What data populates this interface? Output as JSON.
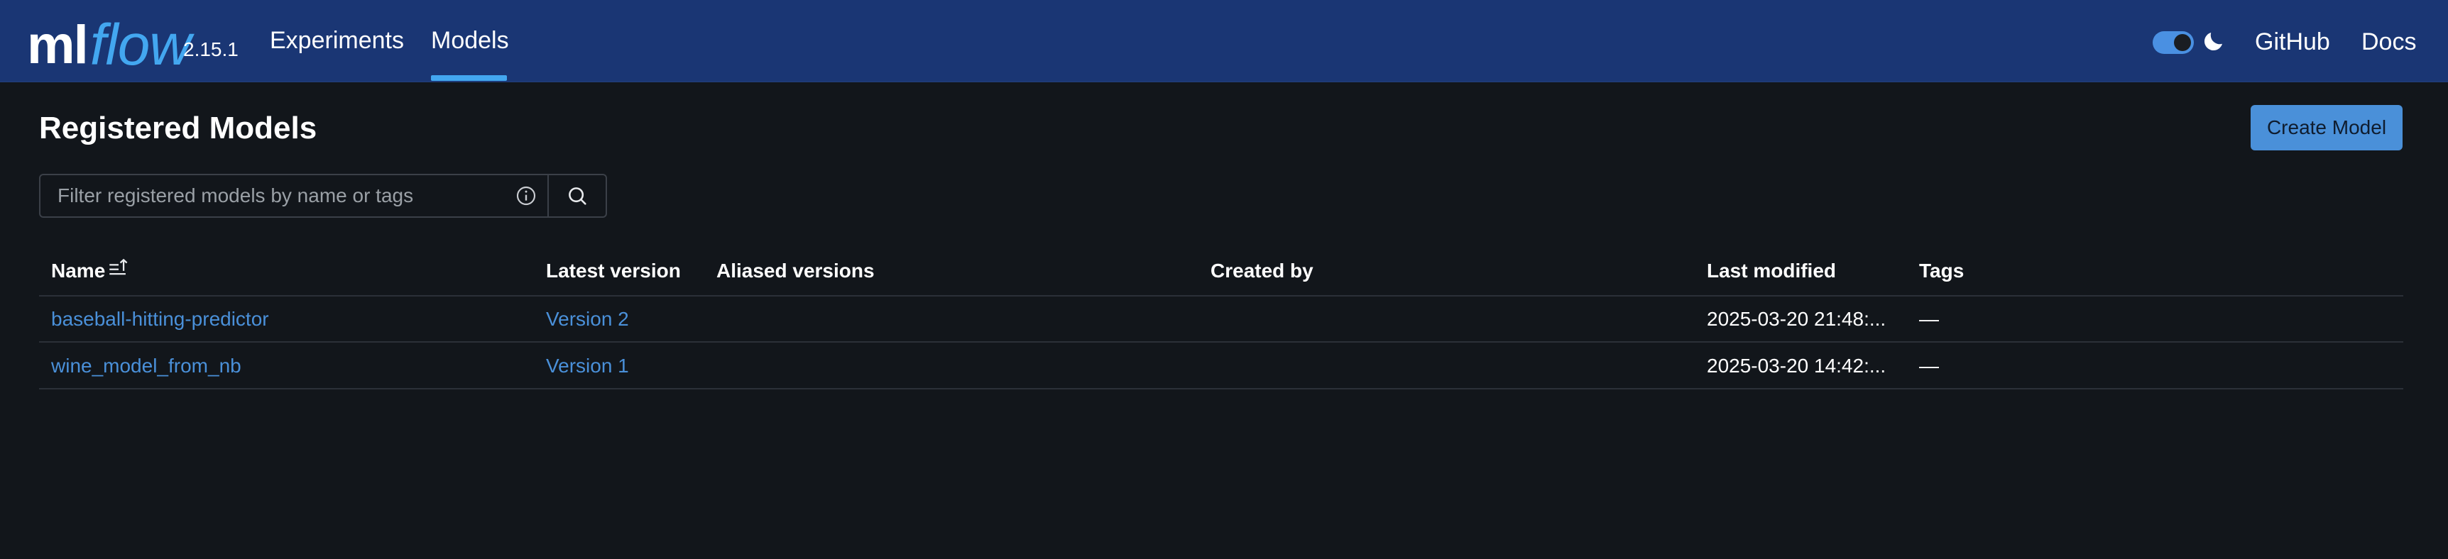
{
  "header": {
    "logo_ml": "ml",
    "logo_flow": "flow",
    "version": "2.15.1",
    "nav": [
      {
        "label": "Experiments",
        "active": false
      },
      {
        "label": "Models",
        "active": true
      }
    ],
    "theme_toggle": "on",
    "moon_icon": "moon-icon",
    "links": [
      "GitHub",
      "Docs"
    ]
  },
  "page": {
    "title": "Registered Models",
    "create_button": "Create Model"
  },
  "search": {
    "placeholder": "Filter registered models by name or tags",
    "info_icon": "info-icon",
    "search_icon": "search-icon"
  },
  "table": {
    "columns": [
      "Name",
      "Latest version",
      "Aliased versions",
      "Created by",
      "Last modified",
      "Tags"
    ],
    "sort_icon": "sort-ascending-icon",
    "rows": [
      {
        "name": "baseball-hitting-predictor",
        "latest_version": "Version 2",
        "aliased_versions": "",
        "created_by": "",
        "last_modified": "2025-03-20 21:48:...",
        "tags": "—"
      },
      {
        "name": "wine_model_from_nb",
        "latest_version": "Version 1",
        "aliased_versions": "",
        "created_by": "",
        "last_modified": "2025-03-20 14:42:...",
        "tags": "—"
      }
    ]
  },
  "colors": {
    "header_bg": "#1a3674",
    "page_bg": "#12161b",
    "accent": "#43a7f0",
    "link": "#4a90d9",
    "button_bg": "#4a90d9"
  }
}
